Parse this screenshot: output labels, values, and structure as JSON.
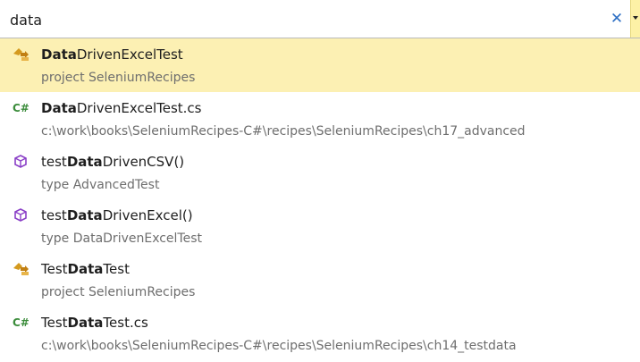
{
  "search": {
    "value": "data",
    "clear_glyph": "✕"
  },
  "results": [
    {
      "icon": "project-icon",
      "pre": "",
      "match": "Data",
      "post": "DrivenExcelTest",
      "subtitle": "project SeleniumRecipes",
      "selected": true
    },
    {
      "icon": "csharp-file-icon",
      "pre": "",
      "match": "Data",
      "post": "DrivenExcelTest.cs",
      "subtitle": "c:\\work\\books\\SeleniumRecipes-C#\\recipes\\SeleniumRecipes\\ch17_advanced",
      "selected": false
    },
    {
      "icon": "method-icon",
      "pre": "test",
      "match": "Data",
      "post": "DrivenCSV()",
      "subtitle": "type AdvancedTest",
      "selected": false
    },
    {
      "icon": "method-icon",
      "pre": "test",
      "match": "Data",
      "post": "DrivenExcel()",
      "subtitle": "type DataDrivenExcelTest",
      "selected": false
    },
    {
      "icon": "project-icon",
      "pre": "Test",
      "match": "Data",
      "post": "Test",
      "subtitle": "project SeleniumRecipes",
      "selected": false
    },
    {
      "icon": "csharp-file-icon",
      "pre": "Test",
      "match": "Data",
      "post": "Test.cs",
      "subtitle": "c:\\work\\books\\SeleniumRecipes-C#\\recipes\\SeleniumRecipes\\ch14_testdata",
      "selected": false
    }
  ],
  "colors": {
    "selected_bg": "#fcf0b3",
    "accent": "#2d6fc4",
    "subtitle": "#6e6e6e"
  },
  "icon_glyphs": {
    "csharp": "C#"
  }
}
